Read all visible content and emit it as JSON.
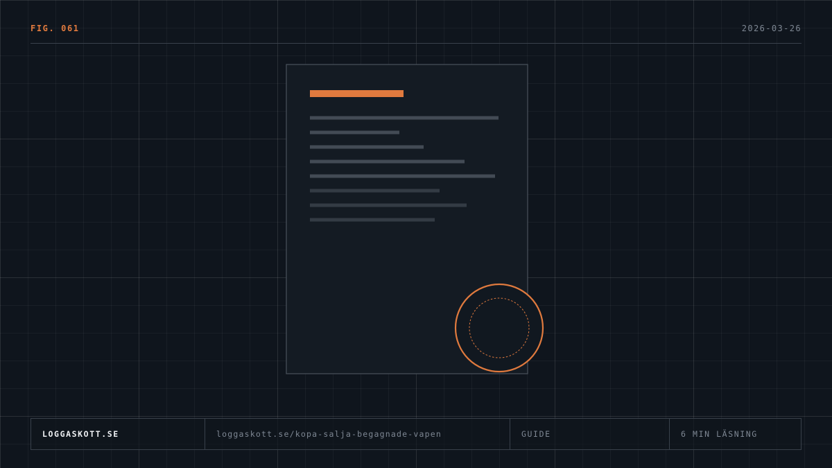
{
  "header": {
    "figure_label": "FIG. 061",
    "date": "2026-03-26"
  },
  "colors": {
    "background": "#0f151d",
    "accent": "#e07a3e",
    "text_muted": "#7e8793",
    "text_bright": "#eef0f3"
  },
  "illustration": {
    "icon": "document-with-seal-icon"
  },
  "footer": {
    "site": "LOGGASKOTT.SE",
    "url": "loggaskott.se/kopa-salja-begagnade-vapen",
    "category": "GUIDE",
    "reading_time": "6 MIN LÄSNING"
  }
}
